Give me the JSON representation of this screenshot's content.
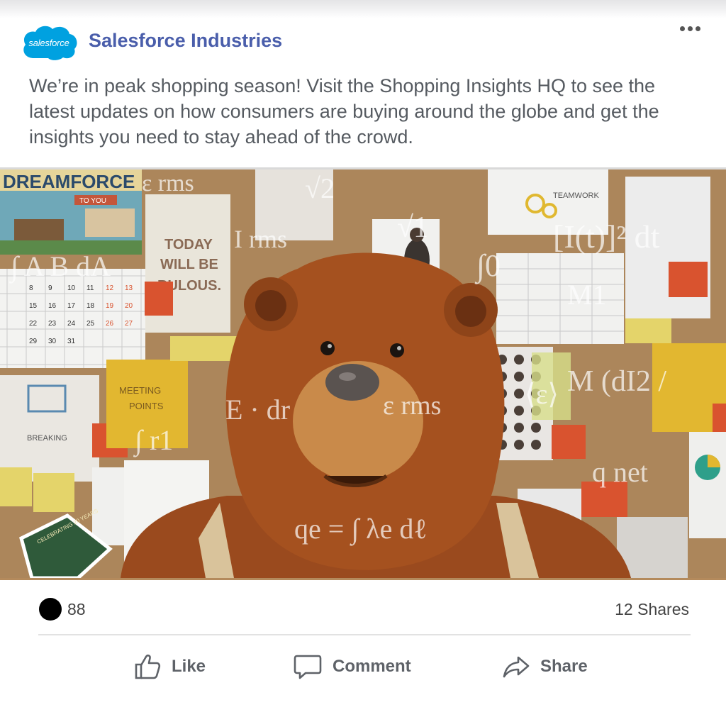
{
  "post": {
    "author": "Salesforce Industries",
    "logo_text": "salesforce",
    "text": "We’re in peak shopping season! Visit the Shopping Insights HQ to see the latest updates on how consumers are buying around the globe and get the insights you need to stay ahead of the crowd.",
    "more_icon": "more-horizontal-icon"
  },
  "media": {
    "board_poster_title": "DREAMFORCE",
    "board_poster_sub": "TO YOU",
    "note_today": "TODAY",
    "note_will_be": "WILL BE",
    "note_fabulous": "BULOUS.",
    "note_meeting": "MEETING",
    "note_points": "POINTS",
    "note_breaking": "BREAKING",
    "note_teamwork": "TEAMWORK",
    "sticker_text": "CELEBRATING 20 YEARS",
    "calendar_numbers": [
      "8",
      "9",
      "10",
      "11",
      "12",
      "13",
      "15",
      "16",
      "17",
      "18",
      "19",
      "20",
      "22",
      "23",
      "24",
      "25",
      "26",
      "27",
      "29",
      "30",
      "31"
    ],
    "math_overlays": [
      "ε rms",
      "√2",
      "√1",
      "∫0",
      "[I(t)]² dt",
      "M1",
      "∫ A B dA",
      "I rms",
      "E · dr",
      "ε rms",
      "⟨ε⟩",
      "M (dI2 /",
      "q net",
      "qe = ∫ λe dℓ",
      "∫ r1"
    ]
  },
  "stats": {
    "reaction_count": "88",
    "shares": "12 Shares"
  },
  "actions": {
    "like": "Like",
    "comment": "Comment",
    "share": "Share"
  },
  "colors": {
    "brand_blue": "#00a1e0",
    "author_blue": "#4a5eab",
    "text_gray": "#555a60"
  }
}
